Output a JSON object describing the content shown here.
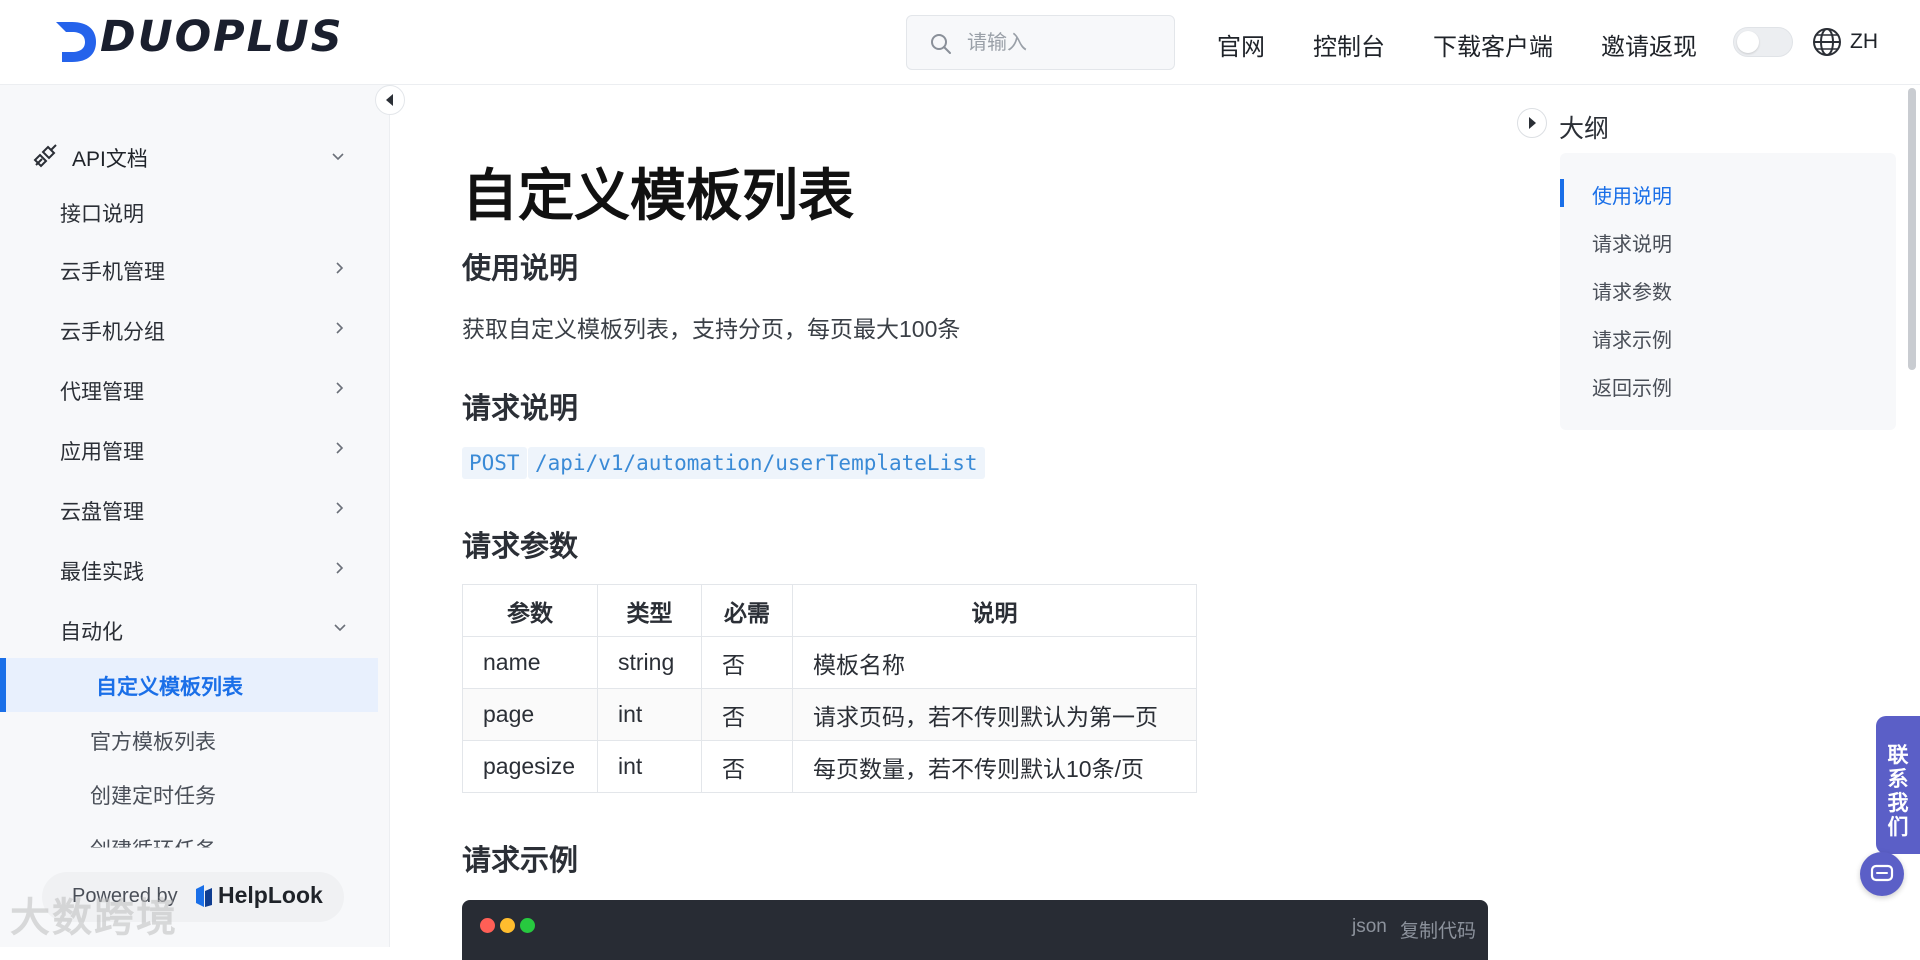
{
  "header": {
    "logo_text": "DUOPLUS",
    "search_placeholder": "请输入",
    "nav": [
      "官网",
      "控制台",
      "下载客户端",
      "邀请返现"
    ],
    "lang": "ZH"
  },
  "sidebar": {
    "top_item": "API文档",
    "items": [
      "接口说明",
      "云手机管理",
      "云手机分组",
      "代理管理",
      "应用管理",
      "云盘管理",
      "最佳实践",
      "自动化"
    ],
    "active_item": "自定义模板列表",
    "sub_items": [
      "官方模板列表",
      "创建定时任务",
      "创建循环任务"
    ],
    "powered_by": "Powered by",
    "powered_brand": "HelpLook",
    "watermark": "大数跨境"
  },
  "main": {
    "title": "自定义模板列表",
    "sections": [
      "使用说明",
      "请求说明",
      "请求参数",
      "请求示例"
    ],
    "description": "获取自定义模板列表，支持分页，每页最大100条",
    "method": "POST",
    "endpoint": "/api/v1/automation/userTemplateList",
    "table": {
      "headers": [
        "参数",
        "类型",
        "必需",
        "说明"
      ],
      "rows": [
        [
          "name",
          "string",
          "否",
          "模板名称"
        ],
        [
          "page",
          "int",
          "否",
          "请求页码，若不传则默认为第一页"
        ],
        [
          "pagesize",
          "int",
          "否",
          "每页数量，若不传则默认10条/页"
        ]
      ]
    },
    "code_lang": "json",
    "copy_label": "复制代码"
  },
  "outline": {
    "title": "大纲",
    "items": [
      "使用说明",
      "请求说明",
      "请求参数",
      "请求示例",
      "返回示例"
    ]
  },
  "contact": {
    "label": "联系我们"
  },
  "colors": {
    "accent": "#1a6fe8",
    "contact": "#5b5fc7"
  }
}
